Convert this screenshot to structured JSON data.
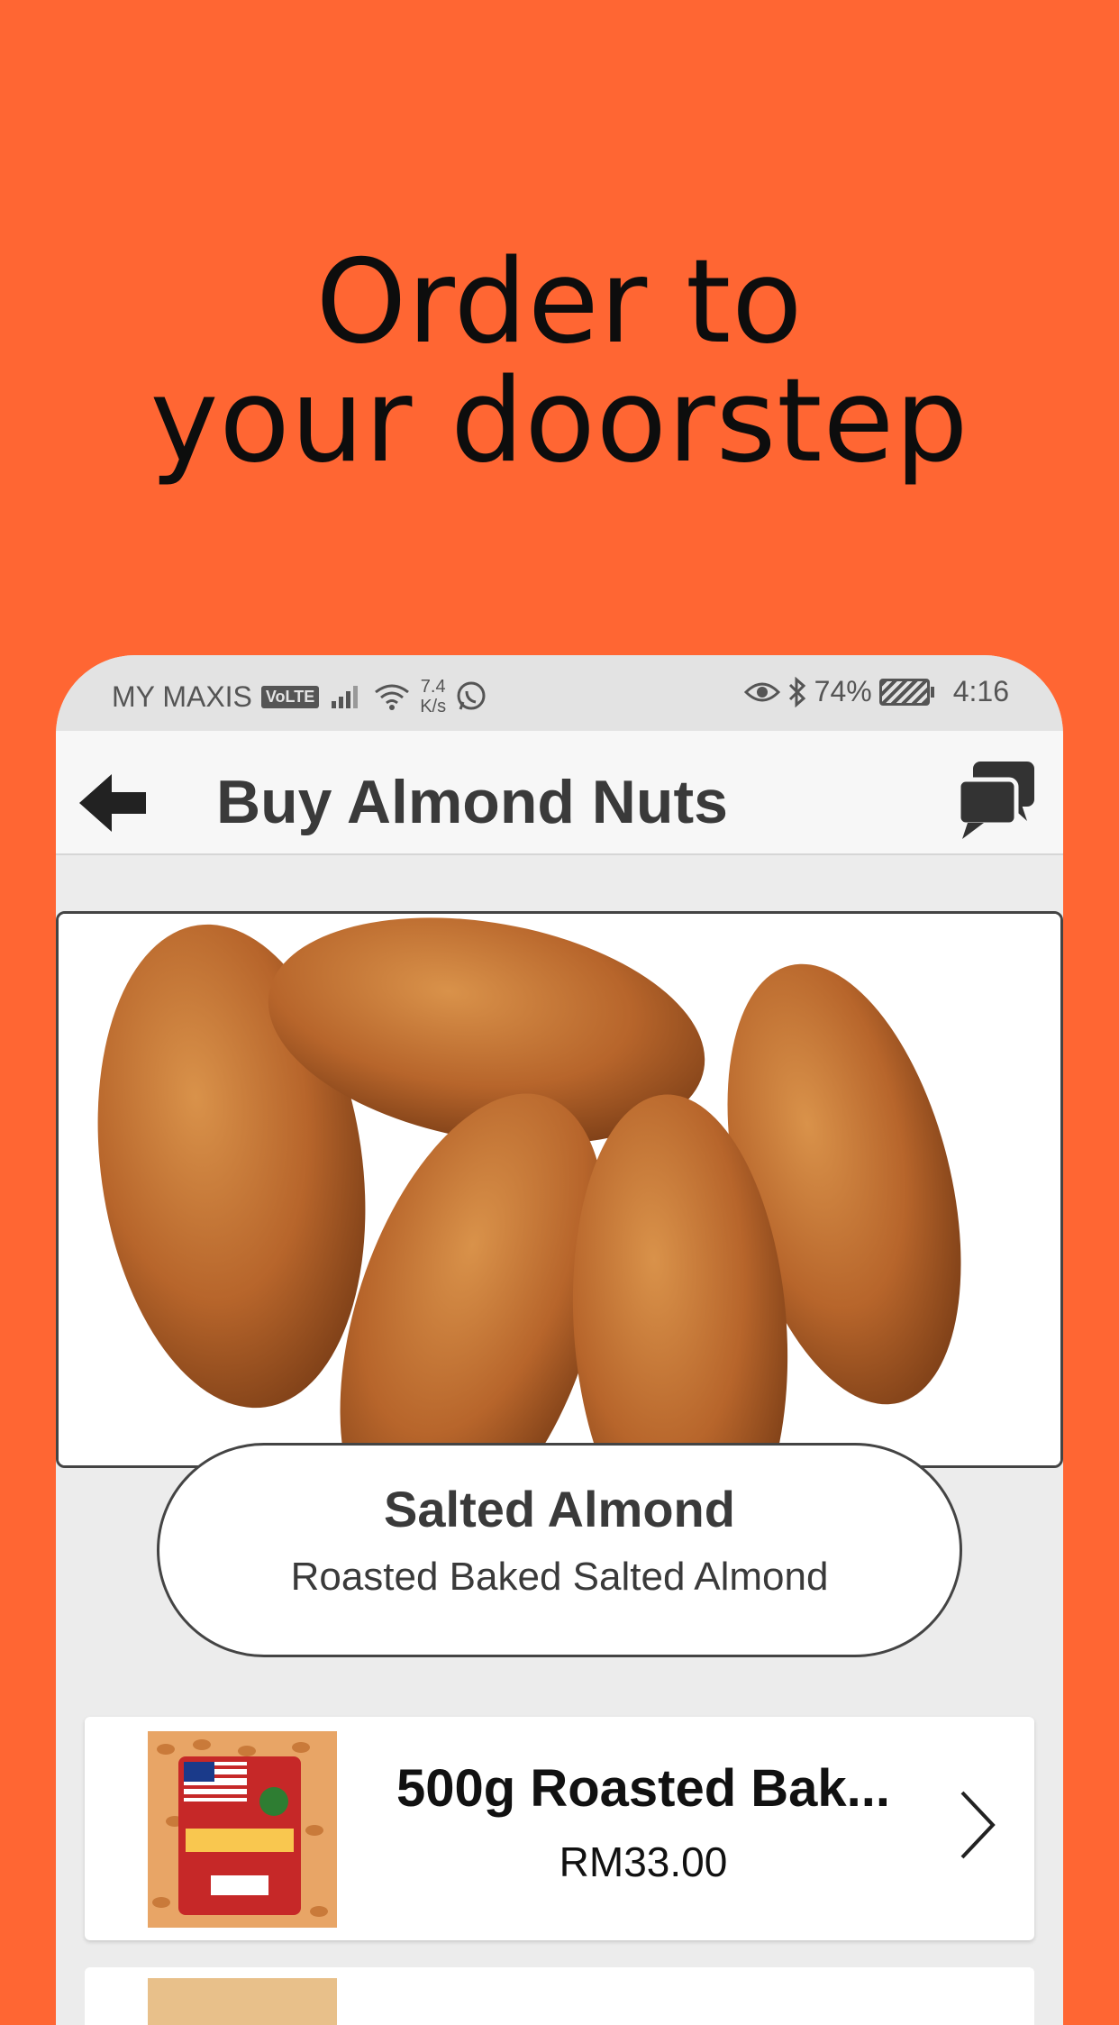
{
  "promo": {
    "headline_line1": "Order to",
    "headline_line2": "your doorstep"
  },
  "status_bar": {
    "carrier": "MY MAXIS",
    "volte": "VoLTE",
    "net_speed_value": "7.4",
    "net_speed_unit": "K/s",
    "battery": "74%",
    "time": "4:16"
  },
  "app_bar": {
    "title": "Buy Almond Nuts",
    "back_icon": "arrow-left-icon",
    "chat_icon": "chat-bubbles-icon"
  },
  "category": {
    "title": "Salted Almond",
    "subtitle": "Roasted Baked Salted Almond"
  },
  "products": [
    {
      "name": "500g Roasted Bak...",
      "price": "RM33.00"
    }
  ],
  "colors": {
    "background": "#FF6633",
    "app_background": "#ECECEC",
    "text_dark": "#3A3A3A"
  }
}
